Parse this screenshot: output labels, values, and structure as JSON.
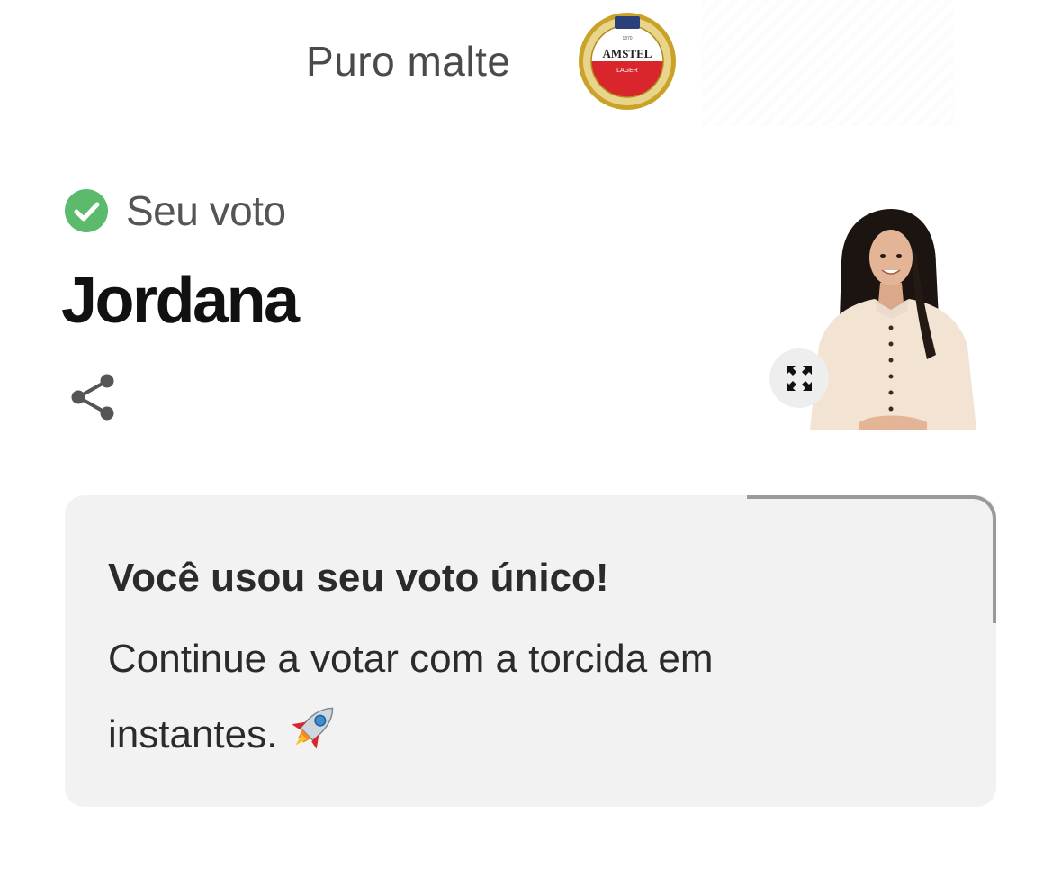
{
  "sponsor": {
    "text": "Puro malte",
    "logo_icon": "amstel-lager-logo-icon",
    "logo_brand": "AMSTEL",
    "logo_sub": "LAGER",
    "accent_red": "#d9262c",
    "accent_gold": "#c9a227"
  },
  "vote": {
    "status_label": "Seu voto",
    "status_icon": "check-circle-icon",
    "status_color": "#5cba6c",
    "candidate_name": "Jordana",
    "share_icon": "share-icon",
    "expand_icon": "expand-arrows-icon"
  },
  "message": {
    "title": "Você usou seu voto único!",
    "body": "Continue a votar com a torcida em instantes.",
    "emoji_icon": "rocket-icon"
  }
}
